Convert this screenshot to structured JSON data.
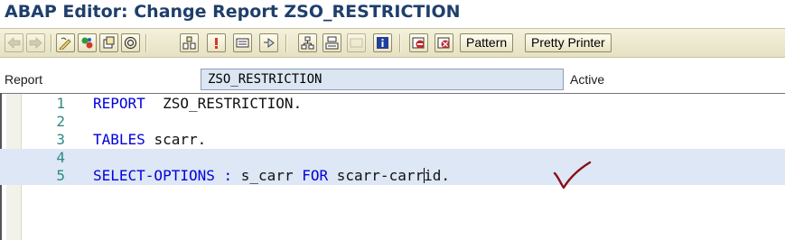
{
  "window": {
    "title": "ABAP Editor: Change Report ZSO_RESTRICTION"
  },
  "toolbar": {
    "pattern_label": "Pattern",
    "pretty_printer_label": "Pretty Printer",
    "icons": [
      "back-arrow-icon",
      "forward-arrow-icon",
      "display-change-icon",
      "active-inactive-icon",
      "other-object-icon",
      "check-syntax-icon",
      "where-used-icon",
      "activate-icon",
      "test-icon",
      "display-object-list-icon",
      "navigation-window-icon",
      "hierarchy-icon",
      "enhance-icon",
      "info-icon",
      "set-breakpoint-icon",
      "session-breakpoint-icon"
    ]
  },
  "header": {
    "report_label": "Report",
    "report_value": "ZSO_RESTRICTION",
    "status": "Active"
  },
  "editor": {
    "lines": [
      {
        "num": "1",
        "tokens": [
          {
            "t": "kw",
            "v": "REPORT"
          },
          {
            "t": "sp",
            "v": "  "
          },
          {
            "t": "id",
            "v": "ZSO_RESTRICTION"
          },
          {
            "t": "pt",
            "v": "."
          }
        ]
      },
      {
        "num": "2",
        "tokens": []
      },
      {
        "num": "3",
        "tokens": [
          {
            "t": "kw",
            "v": "TABLES"
          },
          {
            "t": "sp",
            "v": " "
          },
          {
            "t": "id",
            "v": "scarr"
          },
          {
            "t": "pt",
            "v": "."
          }
        ]
      },
      {
        "num": "4",
        "tokens": []
      },
      {
        "num": "5",
        "tokens": [
          {
            "t": "kw",
            "v": "SELECT-OPTIONS"
          },
          {
            "t": "sp",
            "v": " "
          },
          {
            "t": "op",
            "v": ":"
          },
          {
            "t": "sp",
            "v": " "
          },
          {
            "t": "id",
            "v": "s_carr"
          },
          {
            "t": "sp",
            "v": " "
          },
          {
            "t": "kw",
            "v": "FOR"
          },
          {
            "t": "sp",
            "v": " "
          },
          {
            "t": "id",
            "v": "scarr-carr"
          },
          {
            "t": "cursor",
            "v": ""
          },
          {
            "t": "id",
            "v": "id"
          },
          {
            "t": "pt",
            "v": "."
          }
        ]
      }
    ],
    "highlighted_lines": [
      "4",
      "5"
    ]
  },
  "colors": {
    "keyword": "#0000dd",
    "line_number": "#2f8a86",
    "highlight": "#dde7f5",
    "checkmark": "#8b0d1a",
    "title": "#1f3f6b"
  }
}
